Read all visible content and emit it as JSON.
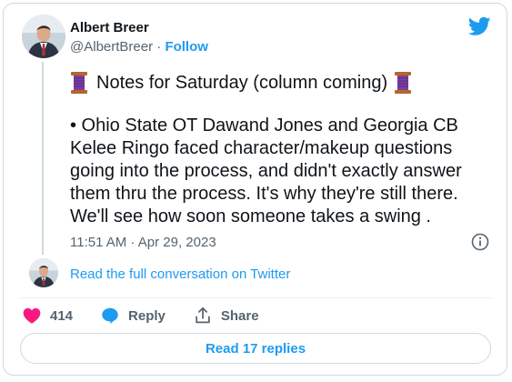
{
  "author": {
    "name": "Albert Breer",
    "handle": "@AlbertBreer",
    "separator": "·",
    "follow_label": "Follow"
  },
  "tweet": {
    "title": "Notes for Saturday (column coming)",
    "title_icon": "spool-of-thread-icon",
    "body": "• Ohio State OT Dawand Jones and Georgia CB Kelee Ringo faced character/makeup questions going into the process, and didn't exactly answer them thru the process. It's why they're still there. We'll see how soon someone takes a swing .",
    "timestamp": "11:51 AM · Apr 29, 2023"
  },
  "conversation_link": "Read the full conversation on Twitter",
  "actions": {
    "like_count": "414",
    "reply_label": "Reply",
    "share_label": "Share"
  },
  "replies_button": "Read 17 replies",
  "colors": {
    "accent": "#1d9bf0",
    "like": "#f91880",
    "text": "#0f1419",
    "muted": "#536471",
    "border": "#cfd9de"
  }
}
